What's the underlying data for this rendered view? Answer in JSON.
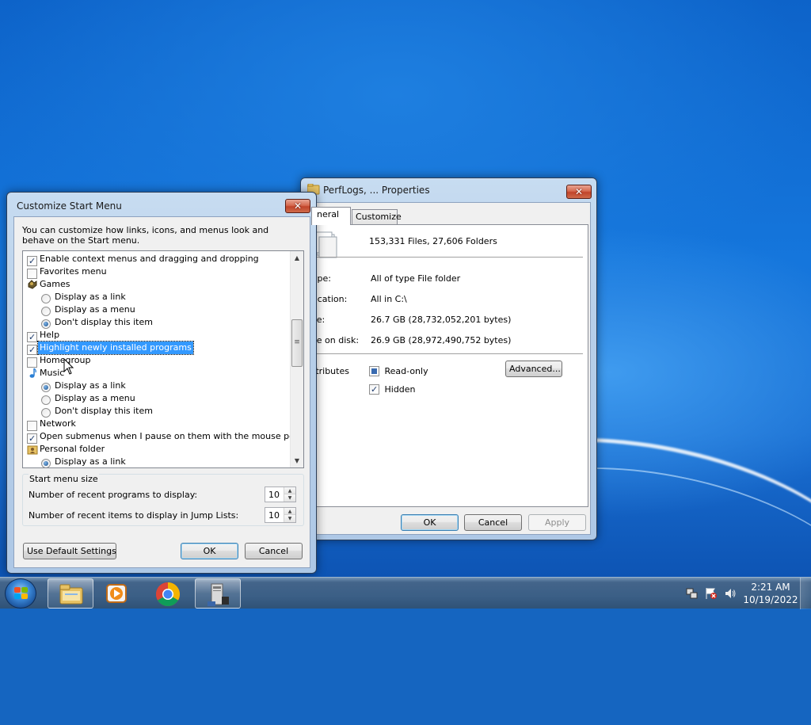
{
  "properties_dialog": {
    "title": "PerfLogs, ... Properties",
    "tabs": [
      "General",
      "Customize"
    ],
    "tab_general_visible": "neral",
    "counts": "153,331 Files, 27,606 Folders",
    "rows": [
      {
        "label": "ype:",
        "value": "All of type File folder"
      },
      {
        "label": "ocation:",
        "value": "All in C:\\"
      },
      {
        "label": "ze:",
        "value": "26.7 GB (28,732,052,201 bytes)"
      },
      {
        "label": "ze on disk:",
        "value": "26.9 GB (28,972,490,752 bytes)"
      }
    ],
    "attributes_label": "ttributes",
    "readonly_label": "Read-only",
    "hidden_label": "Hidden",
    "advanced_label": "Advanced...",
    "ok_label": "OK",
    "cancel_label": "Cancel",
    "apply_label": "Apply"
  },
  "customize_dialog": {
    "title": "Customize Start Menu",
    "description": "You can customize how links, icons, and menus look and behave on the Start menu.",
    "items": [
      {
        "type": "checkbox",
        "checked": true,
        "label": "Enable context menus and dragging and dropping"
      },
      {
        "type": "checkbox",
        "checked": false,
        "label": "Favorites menu"
      },
      {
        "type": "header",
        "icon": "games-icon",
        "label": "Games"
      },
      {
        "type": "radio",
        "checked": false,
        "label": "Display as a link"
      },
      {
        "type": "radio",
        "checked": false,
        "label": "Display as a menu"
      },
      {
        "type": "radio",
        "checked": true,
        "label": "Don't display this item"
      },
      {
        "type": "checkbox",
        "checked": true,
        "label": "Help"
      },
      {
        "type": "checkbox",
        "checked": true,
        "label": "Highlight newly installed programs",
        "selected": true
      },
      {
        "type": "checkbox",
        "checked": false,
        "label": "Homegroup"
      },
      {
        "type": "header",
        "icon": "music-icon",
        "label": "Music"
      },
      {
        "type": "radio",
        "checked": true,
        "label": "Display as a link"
      },
      {
        "type": "radio",
        "checked": false,
        "label": "Display as a menu"
      },
      {
        "type": "radio",
        "checked": false,
        "label": "Don't display this item"
      },
      {
        "type": "checkbox",
        "checked": false,
        "label": "Network"
      },
      {
        "type": "checkbox",
        "checked": true,
        "label": "Open submenus when I pause on them with the mouse pointer"
      },
      {
        "type": "header",
        "icon": "personal-folder-icon",
        "label": "Personal folder"
      },
      {
        "type": "radio",
        "checked": true,
        "label": "Display as a link"
      }
    ],
    "start_menu_size_label": "Start menu size",
    "recent_programs_label": "Number of recent programs to display:",
    "recent_programs_value": "10",
    "recent_items_label": "Number of recent items to display in Jump Lists:",
    "recent_items_value": "10",
    "use_default_label": "Use Default Settings",
    "ok_label": "OK",
    "cancel_label": "Cancel"
  },
  "taskbar": {
    "apps": [
      "windows-explorer",
      "windows-media-player",
      "google-chrome",
      "control-panel"
    ],
    "clock_time": "2:21 AM",
    "clock_date": "10/19/2022"
  }
}
